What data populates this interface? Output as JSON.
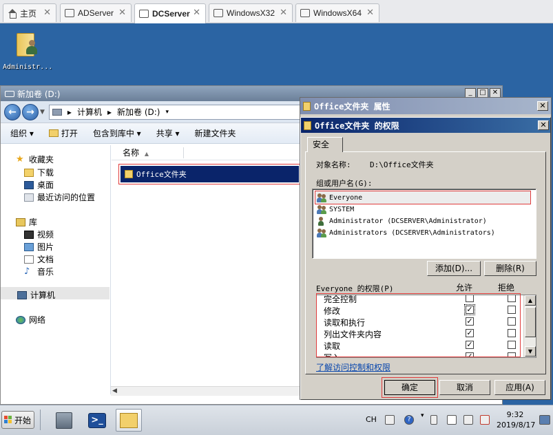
{
  "tabs": [
    {
      "label": "主页",
      "icon": "home-icon"
    },
    {
      "label": "ADServer",
      "icon": "vm-icon"
    },
    {
      "label": "DCServer",
      "icon": "vm-icon",
      "active": true
    },
    {
      "label": "WindowsX32",
      "icon": "vm-icon"
    },
    {
      "label": "WindowsX64",
      "icon": "vm-icon"
    }
  ],
  "desktop": {
    "icon_label": "Administr..."
  },
  "explorer": {
    "title": "新加卷 (D:)",
    "address": {
      "part1": "计算机",
      "sep": "▸",
      "part2": "新加卷 (D:)"
    },
    "toolbar": {
      "organize": "组织 ▾",
      "open": "打开",
      "include": "包含到库中 ▾",
      "share": "共享 ▾",
      "new_folder": "新建文件夹"
    },
    "nav": {
      "favorites": "收藏夹",
      "downloads": "下载",
      "desktop": "桌面",
      "recent": "最近访问的位置",
      "libraries": "库",
      "videos": "视频",
      "pictures": "图片",
      "documents": "文档",
      "music": "音乐",
      "computer": "计算机",
      "network": "网络"
    },
    "column_name": "名称",
    "file": "Office文件夹"
  },
  "props_dialog": {
    "title": "Office文件夹 属性"
  },
  "perm_dialog": {
    "title": "Office文件夹 的权限",
    "tab": "安全",
    "object_label": "对象名称:",
    "object_value": "D:\\Office文件夹",
    "group_label": "组或用户名(G):",
    "users": [
      {
        "name": "Everyone",
        "selected": true
      },
      {
        "name": "SYSTEM"
      },
      {
        "name": "Administrator (DCSERVER\\Administrator)"
      },
      {
        "name": "Administrators (DCSERVER\\Administrators)"
      }
    ],
    "add_button": "添加(D)...",
    "remove_button": "删除(R)",
    "perm_label": "Everyone 的权限(P)",
    "allow_header": "允许",
    "deny_header": "拒绝",
    "permissions": [
      {
        "name": "完全控制",
        "allow": false,
        "deny": false
      },
      {
        "name": "修改",
        "allow": true,
        "deny": false
      },
      {
        "name": "读取和执行",
        "allow": true,
        "deny": false
      },
      {
        "name": "列出文件夹内容",
        "allow": true,
        "deny": false
      },
      {
        "name": "读取",
        "allow": true,
        "deny": false
      },
      {
        "name": "写入",
        "allow": true,
        "deny": false
      }
    ],
    "learn_link": "了解访问控制和权限",
    "ok_button": "确定",
    "cancel_button": "取消",
    "apply_button": "应用(A)"
  },
  "taskbar": {
    "start": "开始",
    "lang": "CH",
    "time": "9:32",
    "date": "2019/8/17"
  },
  "colors": {
    "selection": "#0a246a",
    "highlight_outline": "#e03b3b",
    "desktop": "#2b64a3"
  }
}
